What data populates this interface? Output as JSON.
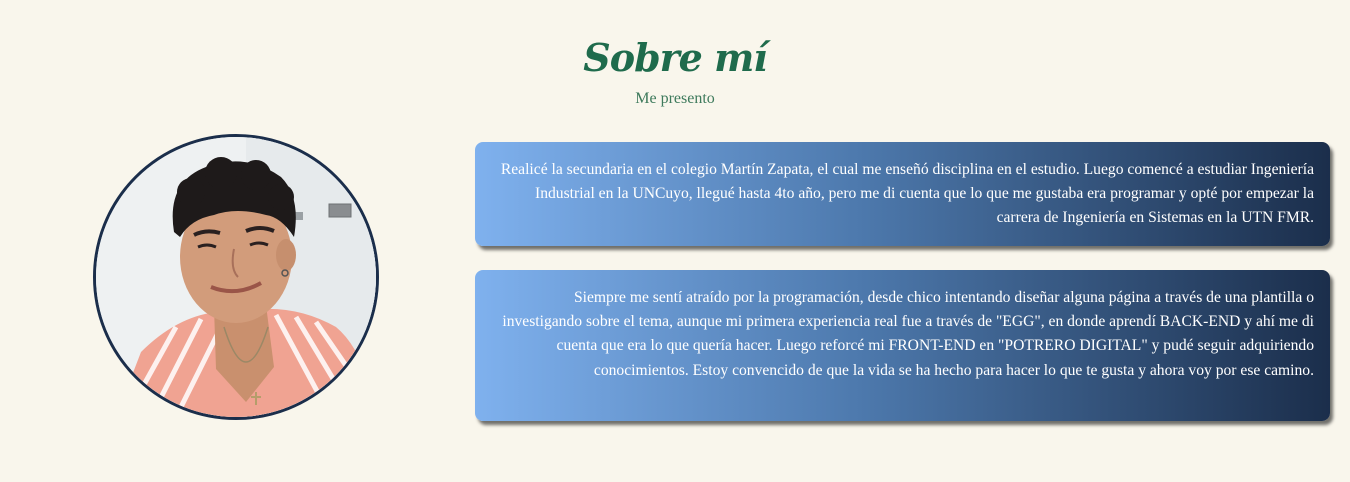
{
  "about": {
    "title": "Sobre mí",
    "subtitle": "Me presento",
    "paragraphs": [
      "Realicé la secundaria en el colegio Martín Zapata, el cual me enseñó disciplina en el estudio. Luego comencé a estudiar Ingeniería Industrial en la UNCuyo, llegué hasta 4to año, pero me di cuenta que lo que me gustaba era programar y opté por empezar la carrera de Ingeniería en Sistemas en la UTN FMR.",
      "Siempre me sentí atraído por la programación, desde chico intentando diseñar alguna página a través de una plantilla o investigando sobre el tema, aunque mi primera experiencia real fue a través de \"EGG\", en donde aprendí BACK-END y ahí me di cuenta que era lo que quería hacer. Luego reforcé mi FRONT-END en \"POTRERO DIGITAL\" y pudé seguir adquiriendo conocimientos. Estoy convencido de que la vida se ha hecho para hacer lo que te gusta y ahora voy por ese camino."
    ]
  },
  "colors": {
    "background": "#f9f6ec",
    "title": "#1f6b4c",
    "subtitle": "#3e7a5c",
    "card_gradient_start": "#7fb1ee",
    "card_gradient_end": "#1b2e4b",
    "photo_border": "#1b2e4b"
  }
}
